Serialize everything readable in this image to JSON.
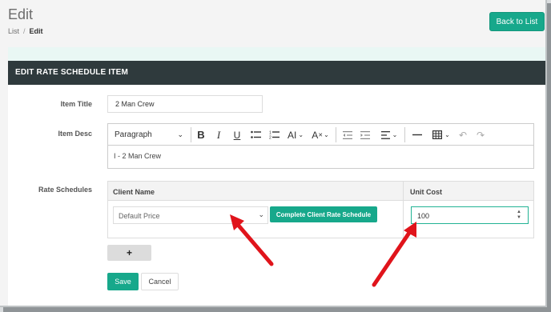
{
  "page": {
    "title": "Edit"
  },
  "breadcrumb": {
    "parent": "List",
    "separator": "/",
    "current": "Edit"
  },
  "header_actions": {
    "back_label": "Back to List"
  },
  "card": {
    "title": "EDIT RATE SCHEDULE ITEM"
  },
  "form": {
    "item_title_label": "Item Title",
    "item_title_value": "2 Man Crew",
    "item_desc_label": "Item Desc",
    "editor": {
      "paragraph_label": "Paragraph",
      "content": "I - 2 Man Crew",
      "tools": [
        "bold-icon",
        "italic-icon",
        "underline-icon",
        "bulleted-list-icon",
        "numbered-list-icon",
        "font-size-icon",
        "text-style-icon",
        "outdent-icon",
        "indent-icon",
        "align-icon",
        "horizontal-line-icon",
        "table-icon",
        "undo-icon",
        "redo-icon"
      ]
    },
    "rate_schedules_label": "Rate Schedules",
    "rate_table": {
      "col_client": "Client Name",
      "col_unit_cost": "Unit Cost",
      "row": {
        "client_value": "Default Price",
        "complete_label": "Complete Client Rate Schedule",
        "unit_cost": "100"
      }
    },
    "add_label": "+",
    "save_label": "Save",
    "cancel_label": "Cancel"
  },
  "colors": {
    "accent": "#17a88b",
    "header": "#2f3a3d",
    "arrow": "#e0141b"
  }
}
